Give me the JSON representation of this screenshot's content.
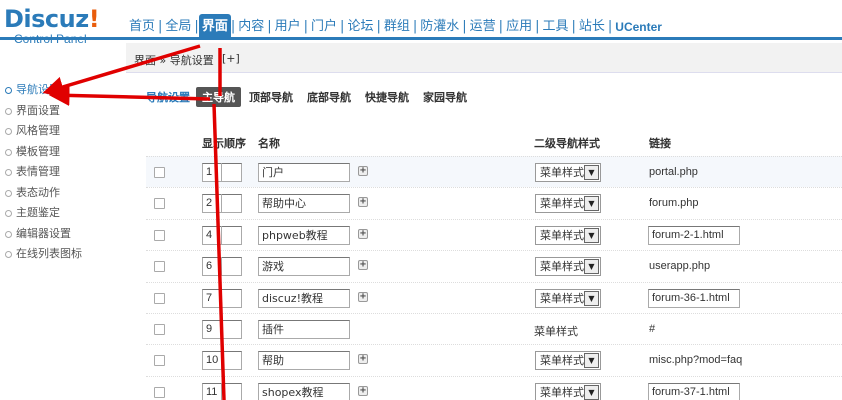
{
  "app": {
    "logo_main": "Discuz",
    "logo_bang": "!",
    "logo_sub": "Control Panel"
  },
  "nav": {
    "items": [
      {
        "label": "首页",
        "active": false
      },
      {
        "label": "全局",
        "active": false
      },
      {
        "label": "界面",
        "active": true
      },
      {
        "label": "内容",
        "active": false
      },
      {
        "label": "用户",
        "active": false
      },
      {
        "label": "门户",
        "active": false
      },
      {
        "label": "论坛",
        "active": false
      },
      {
        "label": "群组",
        "active": false
      },
      {
        "label": "防灌水",
        "active": false
      },
      {
        "label": "运营",
        "active": false
      },
      {
        "label": "应用",
        "active": false
      },
      {
        "label": "工具",
        "active": false
      },
      {
        "label": "站长",
        "active": false
      },
      {
        "label": "UCenter",
        "active": false
      }
    ]
  },
  "breadcrumb": {
    "text": "界面 » 导航设置",
    "add": "[+]"
  },
  "sidebar": {
    "items": [
      {
        "label": "导航设置",
        "active": true
      },
      {
        "label": "界面设置",
        "active": false
      },
      {
        "label": "风格管理",
        "active": false
      },
      {
        "label": "模板管理",
        "active": false
      },
      {
        "label": "表情管理",
        "active": false
      },
      {
        "label": "表态动作",
        "active": false
      },
      {
        "label": "主题鉴定",
        "active": false
      },
      {
        "label": "编辑器设置",
        "active": false
      },
      {
        "label": "在线列表图标",
        "active": false
      }
    ]
  },
  "tabs": {
    "title": "导航设置",
    "items": [
      {
        "label": "主导航",
        "active": true
      },
      {
        "label": "顶部导航",
        "active": false
      },
      {
        "label": "底部导航",
        "active": false
      },
      {
        "label": "快捷导航",
        "active": false
      },
      {
        "label": "家园导航",
        "active": false
      }
    ]
  },
  "table": {
    "headers": {
      "order": "显示顺序",
      "name": "名称",
      "style": "二级导航样式",
      "link": "链接"
    },
    "rows": [
      {
        "order": "1",
        "name": "门户",
        "style": "菜单样式",
        "style_select": true,
        "link": "portal.php",
        "link_editable": false
      },
      {
        "order": "2",
        "name": "帮助中心",
        "style": "菜单样式",
        "style_select": true,
        "link": "forum.php",
        "link_editable": false
      },
      {
        "order": "4",
        "name": "phpweb教程",
        "style": "菜单样式",
        "style_select": true,
        "link": "forum-2-1.html",
        "link_editable": true
      },
      {
        "order": "6",
        "name": "游戏",
        "style": "菜单样式",
        "style_select": true,
        "link": "userapp.php",
        "link_editable": false
      },
      {
        "order": "7",
        "name": "discuz!教程",
        "style": "菜单样式",
        "style_select": true,
        "link": "forum-36-1.html",
        "link_editable": true
      },
      {
        "order": "9",
        "name": "插件",
        "style": "菜单样式",
        "style_select": false,
        "link": "#",
        "link_editable": false
      },
      {
        "order": "10",
        "name": "帮助",
        "style": "菜单样式",
        "style_select": true,
        "link": "misc.php?mod=faq",
        "link_editable": false
      },
      {
        "order": "11",
        "name": "shopex教程",
        "style": "菜单样式",
        "style_select": true,
        "link": "forum-37-1.html",
        "link_editable": true
      }
    ]
  },
  "colors": {
    "accent": "#2b7bb9",
    "annotation": "#e00000"
  }
}
